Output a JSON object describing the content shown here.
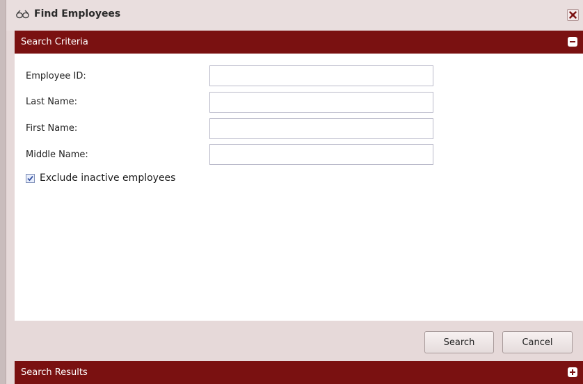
{
  "dialog": {
    "title": "Find Employees",
    "title_icon": "binoculars-icon",
    "close_icon": "close-x-icon"
  },
  "criteria_section": {
    "title": "Search Criteria",
    "toggle_icon": "collapse-minus-icon",
    "fields": [
      {
        "label": "Employee ID:",
        "value": "",
        "placeholder": ""
      },
      {
        "label": "Last Name:",
        "value": "",
        "placeholder": ""
      },
      {
        "label": "First Name:",
        "value": "",
        "placeholder": ""
      },
      {
        "label": "Middle Name:",
        "value": "",
        "placeholder": ""
      }
    ],
    "exclude_inactive": {
      "label": "Exclude inactive employees",
      "checked": true
    }
  },
  "buttons": {
    "search_label": "Search",
    "cancel_label": "Cancel"
  },
  "results_section": {
    "title": "Search Results",
    "toggle_icon": "expand-plus-icon"
  },
  "colors": {
    "header_bg": "#7a1111",
    "dialog_bg": "#e6d9d9",
    "checkbox_check": "#3350a0"
  }
}
